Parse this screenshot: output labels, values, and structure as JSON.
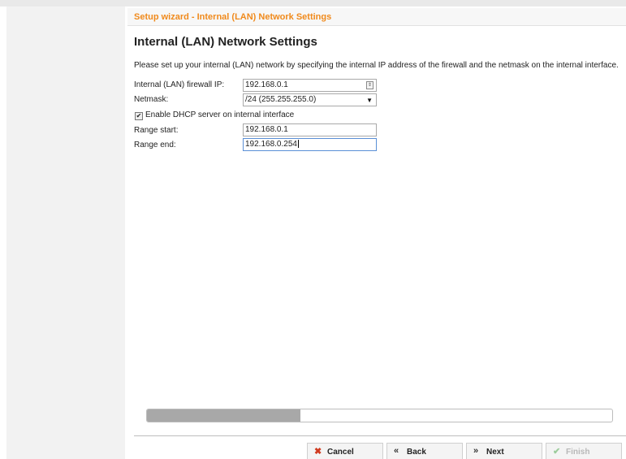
{
  "wizard": {
    "title_bar": "Setup wizard - Internal (LAN) Network Settings",
    "heading": "Internal (LAN) Network Settings",
    "description": "Please set up your internal (LAN) network by specifying the internal IP address of the firewall and the netmask on the internal interface."
  },
  "form": {
    "firewall_ip": {
      "label": "Internal (LAN) firewall IP:",
      "value": "192.168.0.1"
    },
    "netmask": {
      "label": "Netmask:",
      "value": "/24 (255.255.255.0)"
    },
    "dhcp": {
      "label": "Enable DHCP server on internal interface",
      "checked": true,
      "check_glyph": "✔"
    },
    "range_start": {
      "label": "Range start:",
      "value": "192.168.0.1"
    },
    "range_end": {
      "label": "Range end:",
      "value": "192.168.0.254"
    }
  },
  "progress": {
    "fraction": 0.33
  },
  "buttons": {
    "cancel": {
      "label": "Cancel",
      "icon": "✖",
      "icon_color": "#d03a1f"
    },
    "back": {
      "label": "Back",
      "icon": "«",
      "icon_color": "#333333"
    },
    "next": {
      "label": "Next",
      "icon": "»",
      "icon_color": "#333333"
    },
    "finish": {
      "label": "Finish",
      "icon": "✔",
      "icon_color": "#9ccc9c",
      "disabled": true
    }
  },
  "colors": {
    "accent": "#f08a1c",
    "progress": "#a8a8a8"
  }
}
